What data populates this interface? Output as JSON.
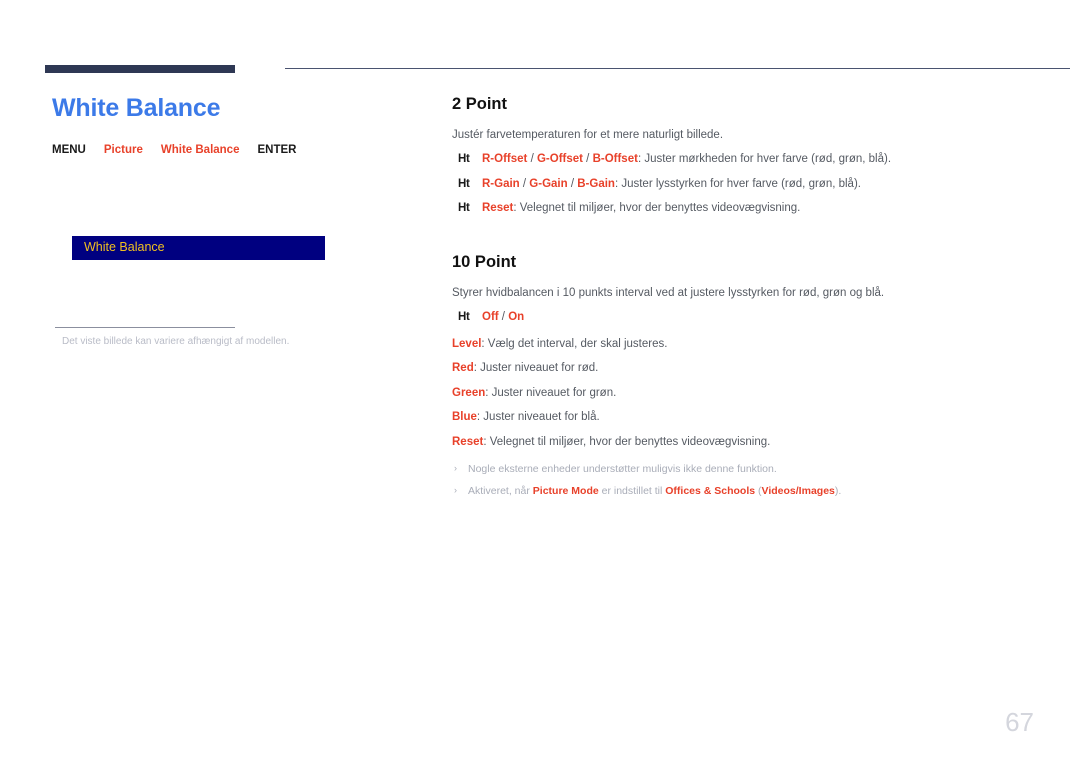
{
  "document": {
    "page_number": "67"
  },
  "left": {
    "title": "White Balance",
    "breadcrumb": {
      "items": [
        {
          "label": "MENU",
          "accent": false
        },
        {
          "label": "Picture",
          "accent": true
        },
        {
          "label": "White Balance",
          "accent": true
        },
        {
          "label": "ENTER",
          "accent": false
        }
      ]
    },
    "osd": {
      "label": "White Balance"
    },
    "caption": "Det viste billede kan variere afhængigt af modellen."
  },
  "right": {
    "sections": [
      {
        "heading": "2 Point",
        "intro": "Justér farvetemperaturen for et mere naturligt billede.",
        "bullets": [
          {
            "marker": "Ht",
            "terms": [
              "R-Offset",
              "G-Offset",
              "B-Offset"
            ],
            "text": ": Juster mørkheden for hver farve (rød, grøn, blå)."
          },
          {
            "marker": "Ht",
            "terms": [
              "R-Gain",
              "G-Gain",
              "B-Gain"
            ],
            "text": ": Juster lysstyrken for hver farve (rød, grøn, blå)."
          },
          {
            "marker": "Ht",
            "terms": [
              "Reset"
            ],
            "text": ": Velegnet til miljøer, hvor der benyttes videovægvisning."
          }
        ]
      },
      {
        "heading": "10 Point",
        "intro": "Styrer hvidbalancen i 10 punkts interval ved at justere lysstyrken for rød, grøn og blå.",
        "toggle": {
          "marker": "Ht",
          "terms": [
            "Off",
            "On"
          ]
        },
        "items": [
          {
            "term": "Level",
            "text": ": Vælg det interval, der skal justeres."
          },
          {
            "term": "Red",
            "text": ": Juster niveauet for rød."
          },
          {
            "term": "Green",
            "text": ": Juster niveauet for grøn."
          },
          {
            "term": "Blue",
            "text": ": Juster niveauet for blå."
          },
          {
            "term": "Reset",
            "text": ": Velegnet til miljøer, hvor der benyttes videovægvisning."
          }
        ],
        "notes": [
          {
            "marker": "›",
            "segments": [
              {
                "text": "Nogle eksterne enheder understøtter muligvis ikke denne funktion.",
                "bold": false
              }
            ]
          },
          {
            "marker": "›",
            "segments": [
              {
                "text": "Aktiveret, når ",
                "bold": false
              },
              {
                "text": "Picture Mode",
                "bold": true
              },
              {
                "text": " er indstillet til ",
                "bold": false
              },
              {
                "text": "Offices & Schools",
                "bold": true
              },
              {
                "text": " (",
                "bold": false
              },
              {
                "text": "Videos/Images",
                "bold": true
              },
              {
                "text": ").",
                "bold": false
              }
            ]
          }
        ]
      }
    ]
  },
  "colors": {
    "title_blue": "#3c7ae8",
    "accent_red": "#e8412a",
    "osd_navy": "#000080",
    "osd_gold": "#f0c020",
    "rule_navy": "#2e3854",
    "body_gray": "#555a62",
    "note_gray": "#a9adb8"
  }
}
